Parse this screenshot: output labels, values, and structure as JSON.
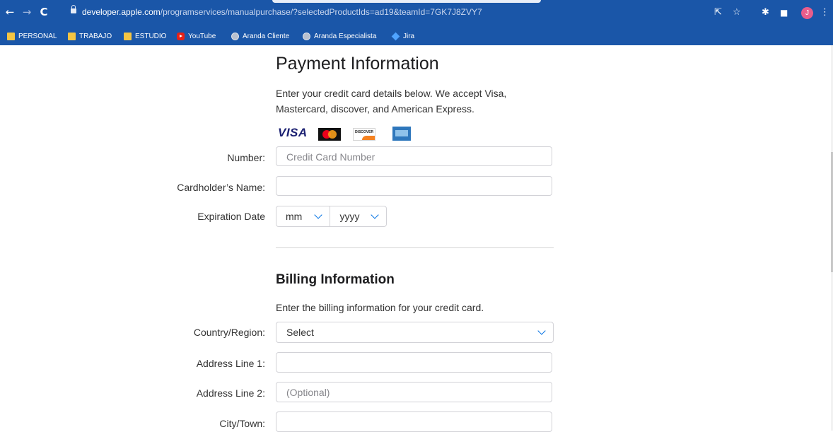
{
  "browser": {
    "url_domain": "developer.apple.com",
    "url_path": "/programservices/manualpurchase/?selectedProductIds=ad19&teamId=7GK7J8ZVY7",
    "profile_initial": "J",
    "bookmarks": [
      {
        "label": "PERSONAL",
        "icon": "folder-icon"
      },
      {
        "label": "TRABAJO",
        "icon": "folder-icon"
      },
      {
        "label": "ESTUDIO",
        "icon": "folder-icon"
      },
      {
        "label": "YouTube",
        "icon": "youtube-icon"
      },
      {
        "label": "Aranda Cliente",
        "icon": "globe-icon"
      },
      {
        "label": "Aranda Especialista",
        "icon": "globe-icon"
      },
      {
        "label": "Jira",
        "icon": "jira-icon"
      }
    ]
  },
  "payment": {
    "title": "Payment Information",
    "description": "Enter your credit card details below. We accept Visa, Mastercard, discover, and American Express.",
    "visa_text": "VISA",
    "discover_text": "DISCOVER",
    "number_label": "Number:",
    "number_placeholder": "Credit Card Number",
    "name_label": "Cardholder’s Name:",
    "expiry_label": "Expiration Date",
    "month_placeholder": "mm",
    "year_placeholder": "yyyy"
  },
  "billing": {
    "title": "Billing Information",
    "description": "Enter the billing information for your credit card.",
    "country_label": "Country/Region:",
    "country_value": "Select",
    "address1_label": "Address Line 1:",
    "address2_label": "Address Line 2:",
    "address2_placeholder": "(Optional)",
    "city_label": "City/Town:"
  }
}
